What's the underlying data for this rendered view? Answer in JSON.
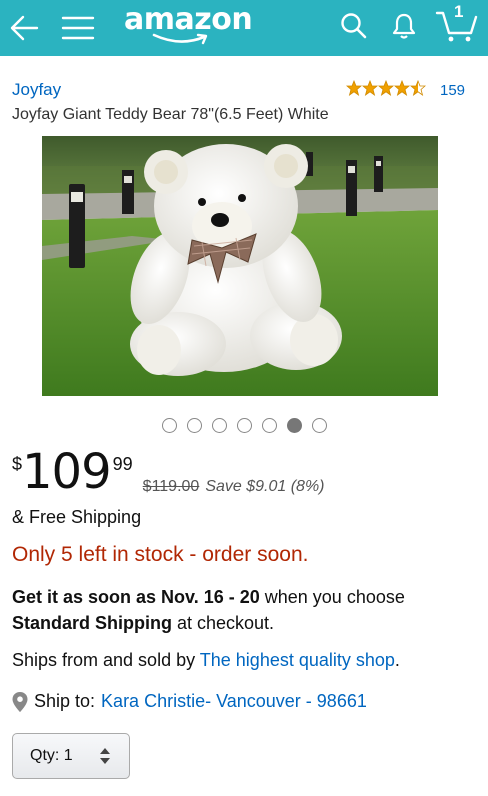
{
  "header": {
    "logo": "amazon",
    "cart_count": "1",
    "bar_color": "#2bb3c0"
  },
  "product": {
    "brand": "Joyfay",
    "review_count": "159",
    "rating_stars": 4.5,
    "title": "Joyfay Giant Teddy Bear 78\"(6.5 Feet) White",
    "image_count": 7,
    "active_image": 6
  },
  "price": {
    "currency": "$",
    "whole": "109",
    "cents": "99",
    "list_price": "$119.00",
    "savings": "Save $9.01 (8%)"
  },
  "shipping": {
    "free_label": "& Free Shipping",
    "stock_message": "Only 5 left in stock - order soon.",
    "delivery_prefix": "Get it as soon as Nov. 16 - 20",
    "delivery_middle": " when you choose ",
    "delivery_method": "Standard Shipping",
    "delivery_suffix": " at checkout.",
    "ships_from_prefix": "Ships from and sold by ",
    "seller": "The highest quality shop",
    "ships_from_suffix": ".",
    "ship_to_label": "Ship to:",
    "ship_to_address": "Kara Christie- Vancouver - 98661"
  },
  "quantity": {
    "label": "Qty:",
    "value": "1"
  },
  "colors": {
    "link": "#0066c0",
    "stock_warning": "#b12704",
    "star": "#f0a000"
  }
}
